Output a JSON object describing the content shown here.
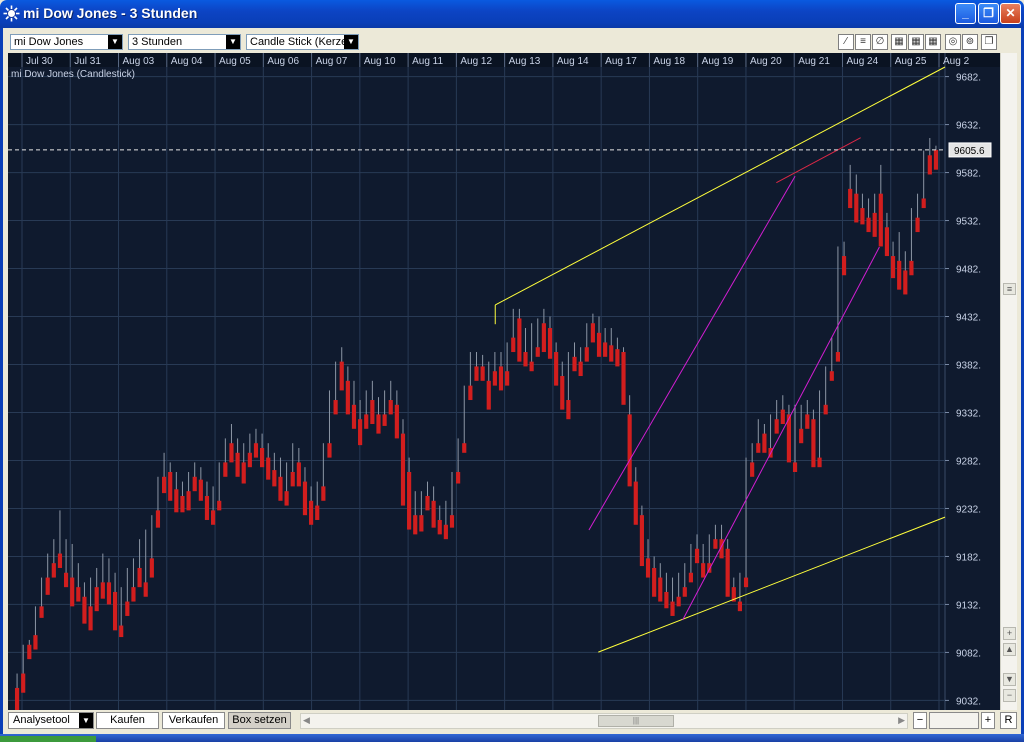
{
  "window": {
    "title": "mi Dow Jones - 3 Stunden",
    "min_glyph": "_",
    "max_glyph": "❐",
    "close_glyph": "✕"
  },
  "toolbar": {
    "symbol": "mi Dow Jones",
    "interval": "3 Stunden",
    "chart_type": "Candle Stick (Kerze",
    "icons": [
      "draw-line-icon",
      "hline-icon",
      "fib-icon",
      "grid-icon",
      "grid-icon",
      "grid-icon",
      "zoom-icon",
      "settings-icon",
      "restore-icon"
    ]
  },
  "colors": {
    "background": "#0f1a2e",
    "grid": "#283a55",
    "up": "#32c81e",
    "down": "#d21e1e",
    "wick": "#8c96a5",
    "channel_yellow": "#ffff3c",
    "channel_magenta": "#d21ed2",
    "trend_red": "#dc2846"
  },
  "chart_data": {
    "type": "candlestick",
    "title": "mi Dow Jones (Candlestick)",
    "x_labels": [
      "Jul 30",
      "Jul 31",
      "Aug 03",
      "Aug 04",
      "Aug 05",
      "Aug 06",
      "Aug 07",
      "Aug 10",
      "Aug 11",
      "Aug 12",
      "Aug 13",
      "Aug 14",
      "Aug 17",
      "Aug 18",
      "Aug 19",
      "Aug 20",
      "Aug 21",
      "Aug 24",
      "Aug 25",
      "Aug 2"
    ],
    "y_ticks": [
      "9682.",
      "9632.",
      "9582.",
      "9532.",
      "9482.",
      "9432.",
      "9382.",
      "9332.",
      "9282.",
      "9232.",
      "9182.",
      "9132.",
      "9082.",
      "9032."
    ],
    "ylim": [
      9022,
      9692
    ],
    "current_price": 9605.6,
    "current_price_label": "9605.6",
    "candles": [
      [
        9045,
        9060,
        9028,
        9020
      ],
      [
        9060,
        9090,
        9045,
        9040
      ],
      [
        9090,
        9095,
        9082,
        9075
      ],
      [
        9100,
        9130,
        9092,
        9085
      ],
      [
        9130,
        9160,
        9125,
        9118
      ],
      [
        9160,
        9185,
        9148,
        9142
      ],
      [
        9175,
        9200,
        9165,
        9160
      ],
      [
        9185,
        9230,
        9175,
        9170
      ],
      [
        9165,
        9200,
        9160,
        9150
      ],
      [
        9160,
        9195,
        9140,
        9130
      ],
      [
        9150,
        9175,
        9140,
        9135
      ],
      [
        9140,
        9155,
        9118,
        9112
      ],
      [
        9130,
        9160,
        9108,
        9105
      ],
      [
        9150,
        9170,
        9130,
        9125
      ],
      [
        9155,
        9185,
        9145,
        9138
      ],
      [
        9155,
        9180,
        9140,
        9132
      ],
      [
        9145,
        9165,
        9110,
        9105
      ],
      [
        9110,
        9150,
        9105,
        9098
      ],
      [
        9135,
        9170,
        9128,
        9120
      ],
      [
        9150,
        9180,
        9140,
        9135
      ],
      [
        9170,
        9200,
        9155,
        9150
      ],
      [
        9155,
        9210,
        9145,
        9140
      ],
      [
        9180,
        9225,
        9165,
        9160
      ],
      [
        9230,
        9265,
        9215,
        9212
      ],
      [
        9265,
        9290,
        9255,
        9248
      ],
      [
        9270,
        9280,
        9245,
        9240
      ],
      [
        9252,
        9270,
        9235,
        9228
      ],
      [
        9245,
        9260,
        9232,
        9228
      ],
      [
        9250,
        9270,
        9235,
        9230
      ],
      [
        9265,
        9280,
        9255,
        9250
      ],
      [
        9262,
        9275,
        9245,
        9240
      ],
      [
        9245,
        9260,
        9225,
        9220
      ],
      [
        9230,
        9255,
        9220,
        9215
      ],
      [
        9240,
        9280,
        9235,
        9230
      ],
      [
        9280,
        9305,
        9270,
        9265
      ],
      [
        9300,
        9320,
        9285,
        9280
      ],
      [
        9290,
        9305,
        9270,
        9265
      ],
      [
        9280,
        9300,
        9262,
        9258
      ],
      [
        9290,
        9310,
        9280,
        9275
      ],
      [
        9300,
        9315,
        9290,
        9285
      ],
      [
        9295,
        9310,
        9280,
        9275
      ],
      [
        9285,
        9300,
        9270,
        9262
      ],
      [
        9272,
        9290,
        9260,
        9255
      ],
      [
        9265,
        9285,
        9245,
        9240
      ],
      [
        9250,
        9280,
        9238,
        9235
      ],
      [
        9270,
        9300,
        9262,
        9255
      ],
      [
        9280,
        9295,
        9260,
        9255
      ],
      [
        9260,
        9275,
        9230,
        9225
      ],
      [
        9240,
        9255,
        9220,
        9215
      ],
      [
        9235,
        9260,
        9225,
        9220
      ],
      [
        9255,
        9300,
        9248,
        9240
      ],
      [
        9300,
        9355,
        9290,
        9285
      ],
      [
        9345,
        9385,
        9340,
        9330
      ],
      [
        9385,
        9400,
        9365,
        9355
      ],
      [
        9365,
        9380,
        9340,
        9330
      ],
      [
        9340,
        9365,
        9320,
        9315
      ],
      [
        9325,
        9345,
        9305,
        9298
      ],
      [
        9330,
        9355,
        9320,
        9315
      ],
      [
        9345,
        9365,
        9325,
        9320
      ],
      [
        9330,
        9348,
        9318,
        9310
      ],
      [
        9330,
        9355,
        9325,
        9318
      ],
      [
        9345,
        9365,
        9338,
        9330
      ],
      [
        9340,
        9355,
        9310,
        9305
      ],
      [
        9310,
        9325,
        9240,
        9235
      ],
      [
        9270,
        9285,
        9215,
        9210
      ],
      [
        9225,
        9250,
        9210,
        9205
      ],
      [
        9225,
        9250,
        9212,
        9208
      ],
      [
        9245,
        9260,
        9235,
        9230
      ],
      [
        9240,
        9255,
        9218,
        9212
      ],
      [
        9220,
        9235,
        9210,
        9205
      ],
      [
        9215,
        9240,
        9205,
        9200
      ],
      [
        9225,
        9270,
        9218,
        9212
      ],
      [
        9270,
        9305,
        9262,
        9258
      ],
      [
        9300,
        9360,
        9295,
        9290
      ],
      [
        9360,
        9395,
        9350,
        9345
      ],
      [
        9380,
        9395,
        9370,
        9365
      ],
      [
        9380,
        9392,
        9370,
        9365
      ],
      [
        9365,
        9385,
        9340,
        9335
      ],
      [
        9375,
        9395,
        9365,
        9360
      ],
      [
        9380,
        9395,
        9360,
        9355
      ],
      [
        9375,
        9405,
        9368,
        9360
      ],
      [
        9410,
        9440,
        9400,
        9395
      ],
      [
        9430,
        9440,
        9390,
        9385
      ],
      [
        9395,
        9420,
        9385,
        9380
      ],
      [
        9385,
        9425,
        9380,
        9375
      ],
      [
        9400,
        9430,
        9395,
        9390
      ],
      [
        9425,
        9440,
        9400,
        9395
      ],
      [
        9420,
        9432,
        9395,
        9388
      ],
      [
        9395,
        9405,
        9365,
        9360
      ],
      [
        9370,
        9385,
        9340,
        9335
      ],
      [
        9345,
        9395,
        9330,
        9325
      ],
      [
        9390,
        9405,
        9380,
        9375
      ],
      [
        9385,
        9400,
        9375,
        9370
      ],
      [
        9400,
        9425,
        9390,
        9385
      ],
      [
        9425,
        9435,
        9410,
        9405
      ],
      [
        9415,
        9432,
        9395,
        9390
      ],
      [
        9405,
        9420,
        9395,
        9390
      ],
      [
        9402,
        9420,
        9390,
        9385
      ],
      [
        9398,
        9410,
        9385,
        9380
      ],
      [
        9395,
        9400,
        9345,
        9340
      ],
      [
        9330,
        9350,
        9260,
        9255
      ],
      [
        9260,
        9275,
        9220,
        9215
      ],
      [
        9225,
        9235,
        9178,
        9172
      ],
      [
        9180,
        9200,
        9165,
        9160
      ],
      [
        9170,
        9182,
        9145,
        9140
      ],
      [
        9160,
        9175,
        9140,
        9135
      ],
      [
        9145,
        9165,
        9135,
        9128
      ],
      [
        9135,
        9160,
        9125,
        9120
      ],
      [
        9140,
        9165,
        9135,
        9130
      ],
      [
        9150,
        9175,
        9145,
        9140
      ],
      [
        9165,
        9195,
        9160,
        9155
      ],
      [
        9190,
        9205,
        9180,
        9175
      ],
      [
        9175,
        9195,
        9165,
        9160
      ],
      [
        9175,
        9205,
        9170,
        9165
      ],
      [
        9200,
        9215,
        9195,
        9190
      ],
      [
        9200,
        9215,
        9185,
        9180
      ],
      [
        9190,
        9200,
        9145,
        9140
      ],
      [
        9150,
        9160,
        9140,
        9135
      ],
      [
        9135,
        9165,
        9130,
        9125
      ],
      [
        9160,
        9285,
        9155,
        9150
      ],
      [
        9280,
        9300,
        9270,
        9265
      ],
      [
        9300,
        9325,
        9295,
        9290
      ],
      [
        9310,
        9320,
        9295,
        9290
      ],
      [
        9295,
        9330,
        9290,
        9285
      ],
      [
        9325,
        9345,
        9315,
        9310
      ],
      [
        9335,
        9350,
        9325,
        9320
      ],
      [
        9330,
        9340,
        9285,
        9280
      ],
      [
        9280,
        9340,
        9275,
        9270
      ],
      [
        9315,
        9340,
        9305,
        9300
      ],
      [
        9330,
        9345,
        9320,
        9315
      ],
      [
        9325,
        9335,
        9280,
        9275
      ],
      [
        9285,
        9355,
        9280,
        9275
      ],
      [
        9340,
        9380,
        9335,
        9330
      ],
      [
        9375,
        9410,
        9370,
        9365
      ],
      [
        9395,
        9505,
        9390,
        9385
      ],
      [
        9495,
        9510,
        9480,
        9475
      ],
      [
        9565,
        9590,
        9550,
        9545
      ],
      [
        9560,
        9580,
        9535,
        9530
      ],
      [
        9545,
        9560,
        9535,
        9528
      ],
      [
        9535,
        9555,
        9525,
        9520
      ],
      [
        9540,
        9560,
        9520,
        9515
      ],
      [
        9560,
        9590,
        9510,
        9505
      ],
      [
        9525,
        9540,
        9500,
        9495
      ],
      [
        9495,
        9510,
        9480,
        9472
      ],
      [
        9490,
        9520,
        9470,
        9460
      ],
      [
        9480,
        9500,
        9460,
        9455
      ],
      [
        9490,
        9545,
        9480,
        9475
      ],
      [
        9535,
        9560,
        9525,
        9520
      ],
      [
        9555,
        9605,
        9550,
        9545
      ],
      [
        9600,
        9618,
        9585,
        9580
      ],
      [
        9605.6,
        9610,
        9590,
        9585
      ]
    ],
    "channels": [
      {
        "color": "yellow",
        "from": [
          0.52,
          0.37
        ],
        "to": [
          1.0,
          0.0
        ]
      },
      {
        "color": "yellow",
        "from": [
          0.63,
          0.91
        ],
        "to": [
          1.0,
          0.7
        ]
      },
      {
        "color": "magenta",
        "from": [
          0.62,
          0.72
        ],
        "to": [
          0.84,
          0.17
        ]
      },
      {
        "color": "magenta",
        "from": [
          0.72,
          0.86
        ],
        "to": [
          0.93,
          0.28
        ]
      },
      {
        "color": "red",
        "from": [
          0.82,
          0.18
        ],
        "to": [
          0.91,
          0.11
        ]
      }
    ]
  },
  "bottom": {
    "analysetool": "Analysetool",
    "kaufen": "Kaufen",
    "verkaufen": "Verkaufen",
    "box_setzen": "Box setzen",
    "scroll_thumb_glyph": "|||",
    "zoom_minus": "−",
    "zoom_plus": "+",
    "reset": "R"
  }
}
